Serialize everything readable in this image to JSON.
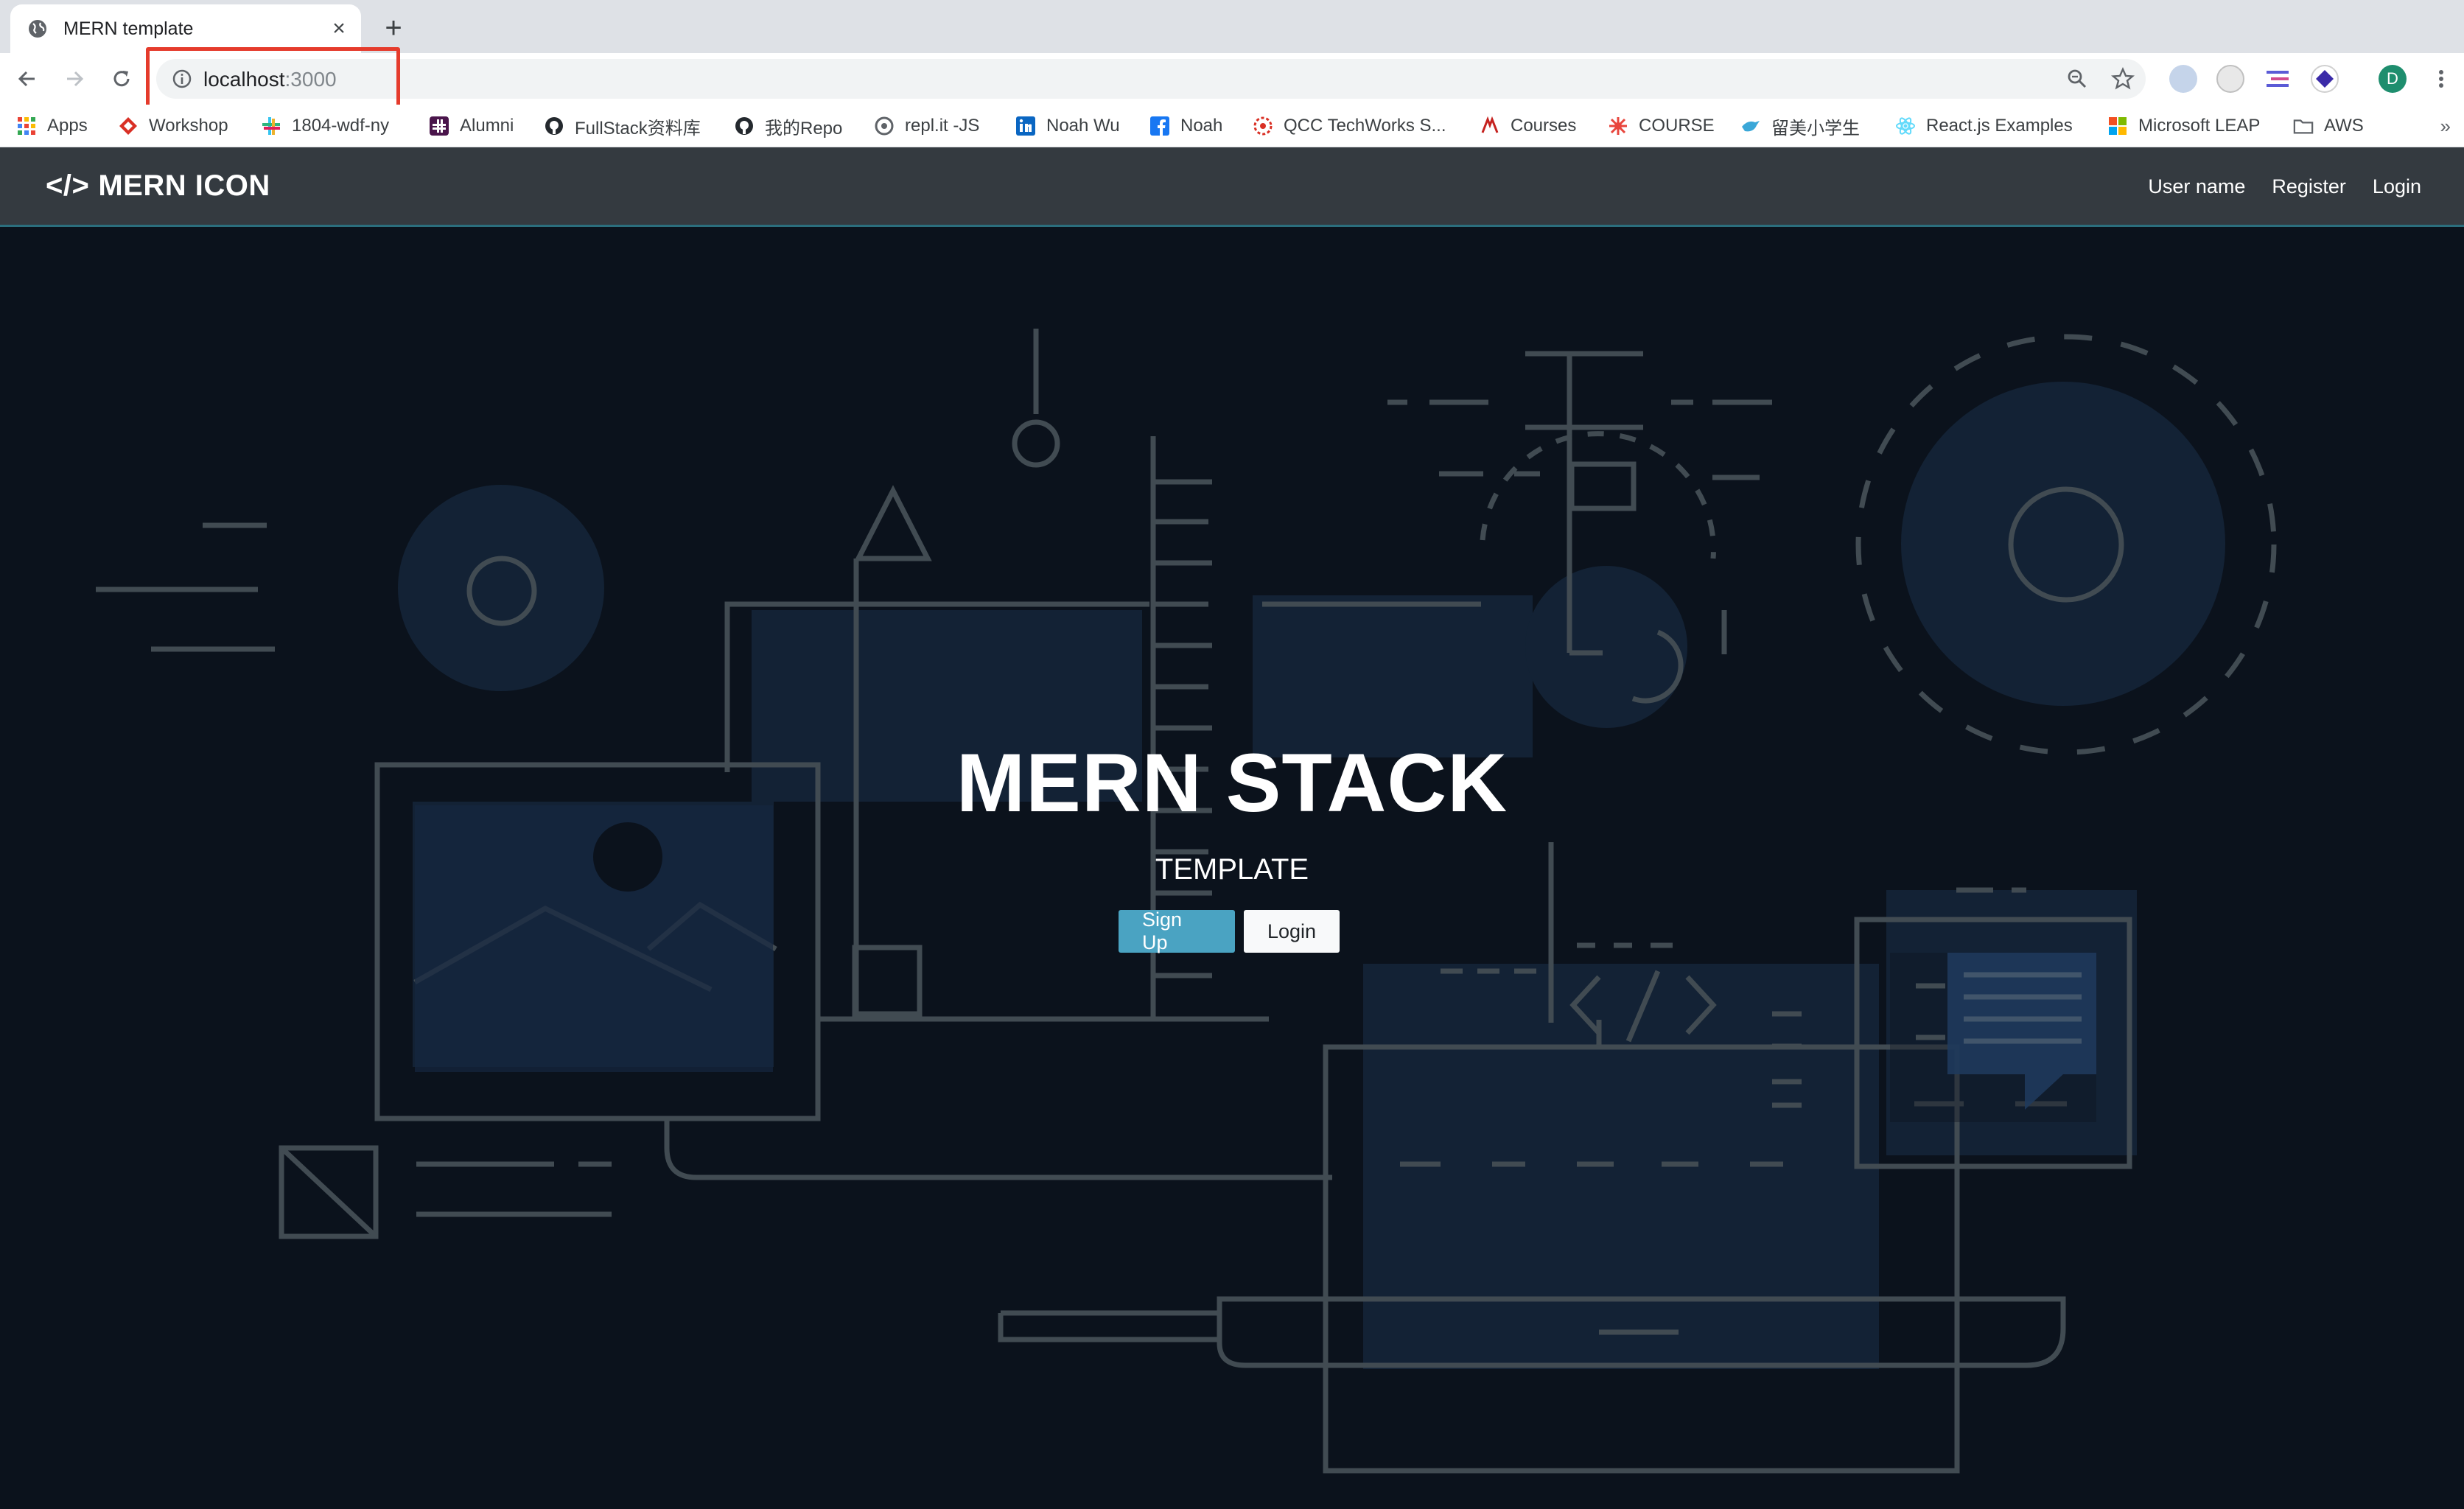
{
  "browser": {
    "tab_title": "MERN template",
    "new_tab_label": "+",
    "close_label": "×",
    "url_host": "localhost",
    "url_port": ":3000",
    "profile_initial": "D"
  },
  "bookmarks": {
    "items": [
      {
        "label": "Apps",
        "icon": "apps-grid-icon"
      },
      {
        "label": "Workshop",
        "icon": "workshop-icon"
      },
      {
        "label": "1804-wdf-ny",
        "icon": "slack-icon"
      },
      {
        "label": "Alumni",
        "icon": "slack-icon"
      },
      {
        "label": "FullStack资料库",
        "icon": "github-icon"
      },
      {
        "label": "我的Repo",
        "icon": "github-icon"
      },
      {
        "label": "repl.it -JS",
        "icon": "replit-icon"
      },
      {
        "label": "Noah Wu",
        "icon": "linkedin-icon"
      },
      {
        "label": "Noah",
        "icon": "facebook-icon"
      },
      {
        "label": "QCC TechWorks S...",
        "icon": "qcc-icon"
      },
      {
        "label": "Courses",
        "icon": "courses-icon"
      },
      {
        "label": "COURSE",
        "icon": "course-icon"
      },
      {
        "label": "留美小学生",
        "icon": "bird-icon"
      },
      {
        "label": "React.js Examples",
        "icon": "react-icon"
      },
      {
        "label": "Microsoft LEAP",
        "icon": "microsoft-icon"
      },
      {
        "label": "AWS",
        "icon": "folder-icon"
      }
    ],
    "more_label": "»"
  },
  "navbar": {
    "brand_icon": "</>",
    "brand": "MERN ICON",
    "links": [
      "User name",
      "Register",
      "Login"
    ]
  },
  "hero": {
    "title": "MERN STACK",
    "subtitle": "TEMPLATE",
    "primary_button": "Sign Up",
    "secondary_button": "Login"
  },
  "colors": {
    "navbar_bg": "#343a40",
    "hero_bg": "#0b121c",
    "primary_button": "#4aa3c2",
    "highlight_box": "#e53b2c"
  }
}
